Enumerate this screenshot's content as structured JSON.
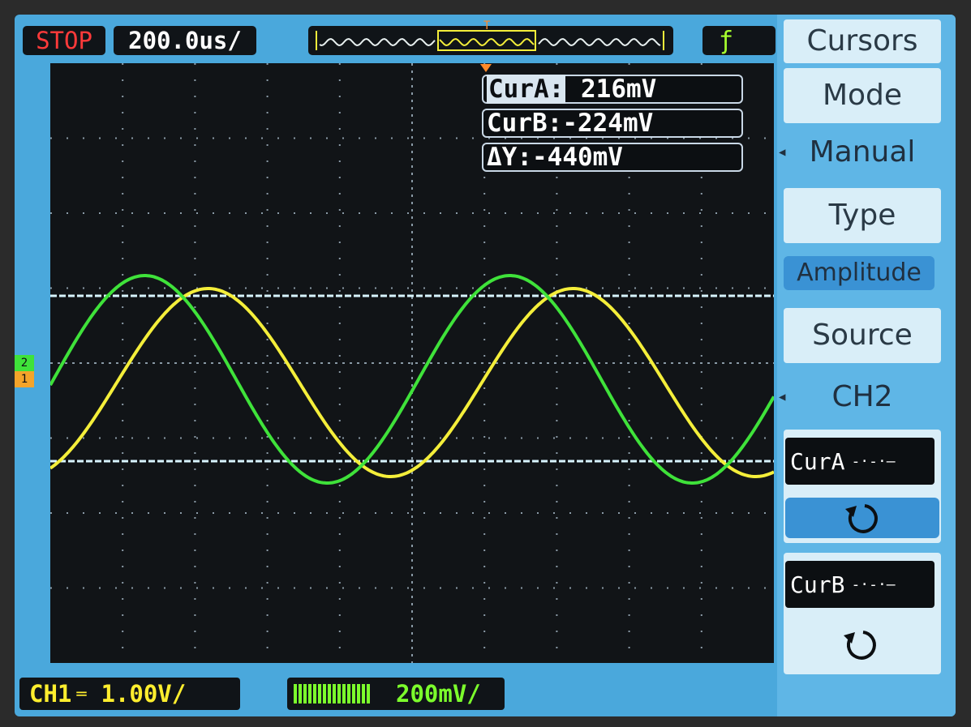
{
  "status": {
    "run_state": "STOP",
    "timebase": "200.0us/"
  },
  "trigger": {
    "symbol": "ƒ"
  },
  "menu": {
    "title": "Cursors",
    "mode_label": "Mode",
    "mode_value": "Manual",
    "type_label": "Type",
    "type_value": "Amplitude",
    "source_label": "Source",
    "source_value": "CH2",
    "cursor_a": "CurA",
    "cursor_b": "CurB"
  },
  "readouts": {
    "cur_a_label": "CurA:",
    "cur_a_value": " 216mV",
    "cur_b": "CurB:-224mV",
    "delta_y": "ΔY:-440mV"
  },
  "channels": {
    "ch1_label": "CH1",
    "ch1_scale": "1.00V/",
    "ch2_scale": "200mV/"
  },
  "markers": {
    "ch2_marker": "2",
    "ch1_marker": "1"
  },
  "colors": {
    "ch1": "#f4ee3a",
    "ch2": "#3fe23a",
    "cursor": "#d8f4ff",
    "stop": "#ff3a3a",
    "menu_bg": "#5fb6e6"
  }
}
